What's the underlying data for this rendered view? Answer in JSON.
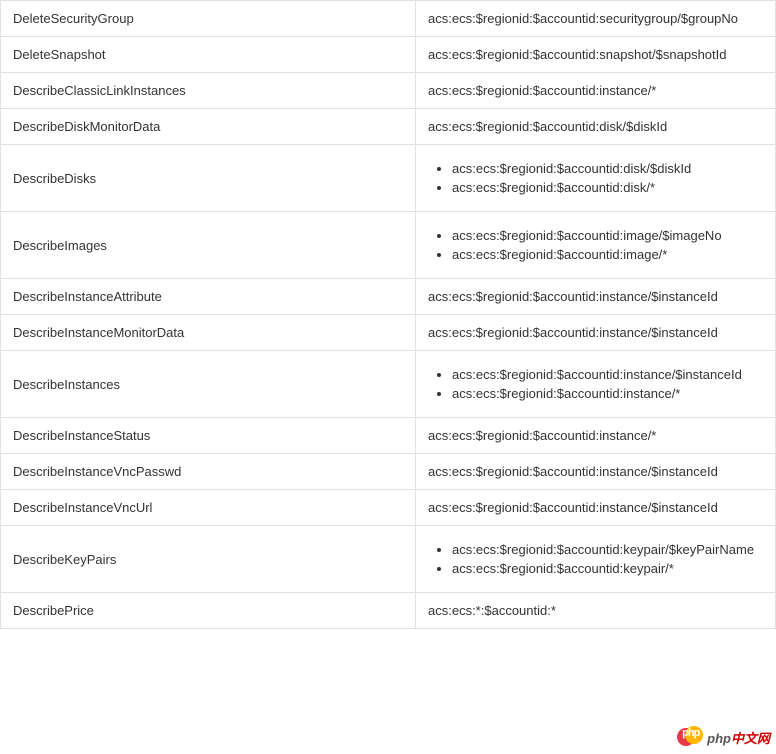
{
  "rows": [
    {
      "action": "DeleteSecurityGroup",
      "resources": [
        "acs:ecs:$regionid:$accountid:securitygroup/$groupNo"
      ],
      "list": false
    },
    {
      "action": "DeleteSnapshot",
      "resources": [
        "acs:ecs:$regionid:$accountid:snapshot/$snapshotId"
      ],
      "list": false
    },
    {
      "action": "DescribeClassicLinkInstances",
      "resources": [
        "acs:ecs:$regionid:$accountid:instance/*"
      ],
      "list": false
    },
    {
      "action": "DescribeDiskMonitorData",
      "resources": [
        "acs:ecs:$regionid:$accountid:disk/$diskId"
      ],
      "list": false
    },
    {
      "action": "DescribeDisks",
      "resources": [
        "acs:ecs:$regionid:$accountid:disk/$diskId",
        "acs:ecs:$regionid:$accountid:disk/*"
      ],
      "list": true
    },
    {
      "action": "DescribeImages",
      "resources": [
        "acs:ecs:$regionid:$accountid:image/$imageNo",
        "acs:ecs:$regionid:$accountid:image/*"
      ],
      "list": true
    },
    {
      "action": "DescribeInstanceAttribute",
      "resources": [
        "acs:ecs:$regionid:$accountid:instance/$instanceId"
      ],
      "list": false
    },
    {
      "action": "DescribeInstanceMonitorData",
      "resources": [
        "acs:ecs:$regionid:$accountid:instance/$instanceId"
      ],
      "list": false
    },
    {
      "action": "DescribeInstances",
      "resources": [
        "acs:ecs:$regionid:$accountid:instance/$instanceId",
        "acs:ecs:$regionid:$accountid:instance/*"
      ],
      "list": true
    },
    {
      "action": "DescribeInstanceStatus",
      "resources": [
        "acs:ecs:$regionid:$accountid:instance/*"
      ],
      "list": false
    },
    {
      "action": "DescribeInstanceVncPasswd",
      "resources": [
        "acs:ecs:$regionid:$accountid:instance/$instanceId"
      ],
      "list": false
    },
    {
      "action": "DescribeInstanceVncUrl",
      "resources": [
        "acs:ecs:$regionid:$accountid:instance/$instanceId"
      ],
      "list": false
    },
    {
      "action": "DescribeKeyPairs",
      "resources": [
        "acs:ecs:$regionid:$accountid:keypair/$keyPairName",
        "acs:ecs:$regionid:$accountid:keypair/*"
      ],
      "list": true
    },
    {
      "action": "DescribePrice",
      "resources": [
        "acs:ecs:*:$accountid:*"
      ],
      "list": false
    }
  ],
  "watermark": {
    "brand_zh": "中文网",
    "brand_prefix": "php"
  }
}
